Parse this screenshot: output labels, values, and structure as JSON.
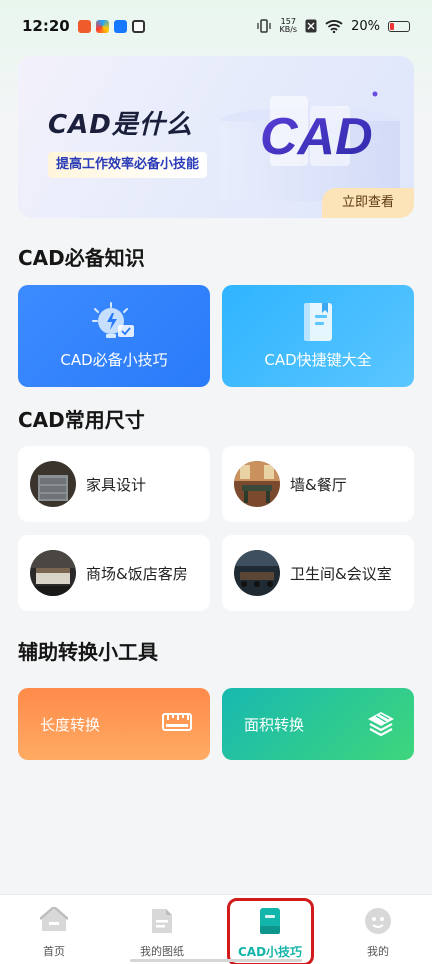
{
  "status_bar": {
    "time": "12:20",
    "net_speed_value": "157",
    "net_speed_unit": "KB/s",
    "battery_percent": "20%",
    "battery_level": 0.2
  },
  "banner": {
    "title": "CAD是什么",
    "subtitle": "提高工作效率必备小技能",
    "logo_text": "CAD",
    "cta": "立即查看"
  },
  "sections": {
    "knowledge_title": "CAD必备知识",
    "sizes_title": "CAD常用尺寸",
    "tools_title": "辅助转换小工具"
  },
  "knowledge_cards": [
    {
      "label": "CAD必备小技巧",
      "icon": "lightbulb-icon"
    },
    {
      "label": "CAD快捷键大全",
      "icon": "book-icon"
    }
  ],
  "size_cards": [
    {
      "label": "家具设计"
    },
    {
      "label": "墙&餐厅"
    },
    {
      "label": "商场&饭店客房"
    },
    {
      "label": "卫生间&会议室"
    }
  ],
  "tool_cards": [
    {
      "label": "长度转换",
      "icon": "ruler-icon"
    },
    {
      "label": "面积转换",
      "icon": "layers-icon"
    }
  ],
  "tabbar": {
    "tabs": [
      {
        "label": "首页",
        "icon": "home-icon"
      },
      {
        "label": "我的图纸",
        "icon": "document-icon"
      },
      {
        "label": "CAD小技巧",
        "icon": "book-icon",
        "active": true
      },
      {
        "label": "我的",
        "icon": "profile-icon"
      }
    ]
  },
  "colors": {
    "accent": "#12b5a9",
    "blue_card": "#2a7bfa",
    "sky_card": "#3fbcff",
    "orange_card": "#ff9a55",
    "green_card": "#2ccb8f",
    "highlight": "#d21a1a"
  }
}
